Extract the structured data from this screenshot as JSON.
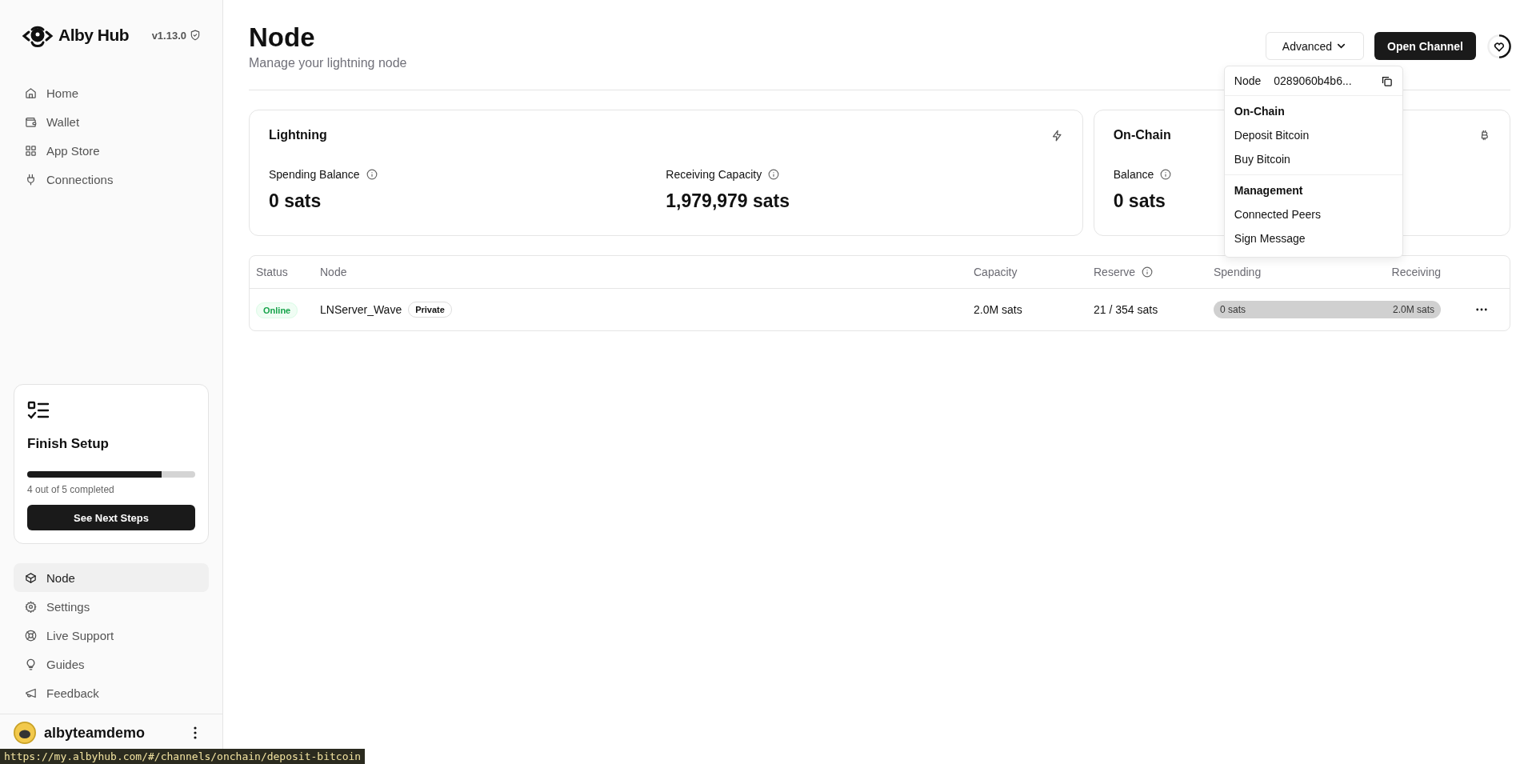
{
  "sidebar": {
    "brand": "Alby Hub",
    "version": "v1.13.0",
    "nav_top": [
      {
        "label": "Home",
        "selected": false
      },
      {
        "label": "Wallet",
        "selected": false
      },
      {
        "label": "App Store",
        "selected": false
      },
      {
        "label": "Connections",
        "selected": false
      }
    ],
    "setup_card": {
      "title": "Finish Setup",
      "level": 0.8,
      "progress_text": "4 out of 5 completed",
      "button": "See Next Steps"
    },
    "nav_bottom": [
      {
        "label": "Node",
        "selected": true
      },
      {
        "label": "Settings",
        "selected": false
      },
      {
        "label": "Live Support",
        "selected": false
      },
      {
        "label": "Guides",
        "selected": false
      },
      {
        "label": "Feedback",
        "selected": false
      }
    ],
    "user": {
      "name": "albyteamdemo"
    }
  },
  "header": {
    "title": "Node",
    "subtitle": "Manage your lightning node",
    "advanced_button": "Advanced",
    "open_channel_button": "Open Channel"
  },
  "dropdown": {
    "node_label": "Node",
    "node_id": "0289060b4b6...",
    "sections": [
      {
        "heading": "On-Chain",
        "items": [
          "Deposit Bitcoin",
          "Buy Bitcoin"
        ]
      },
      {
        "heading": "Management",
        "items": [
          "Connected Peers",
          "Sign Message"
        ]
      }
    ]
  },
  "cards": [
    {
      "title": "Lightning",
      "stats": [
        {
          "label": "Spending Balance",
          "value": "0 sats"
        },
        {
          "label": "Receiving Capacity",
          "value": "1,979,979 sats"
        }
      ]
    },
    {
      "title": "On-Chain",
      "stats": [
        {
          "label": "Balance",
          "value": "0 sats"
        }
      ]
    }
  ],
  "table": {
    "columns": [
      "Status",
      "Node",
      "Capacity",
      "Reserve",
      "Spending",
      "Receiving"
    ],
    "rows": [
      {
        "status": "Online",
        "node": "LNServer_Wave",
        "badge": "Private",
        "capacity": "2.0M sats",
        "reserve": "21 / 354 sats",
        "spending": "0 sats",
        "receiving": "2.0M sats"
      }
    ]
  },
  "status_url": "https://my.albyhub.com/#/channels/onchain/deposit-bitcoin"
}
